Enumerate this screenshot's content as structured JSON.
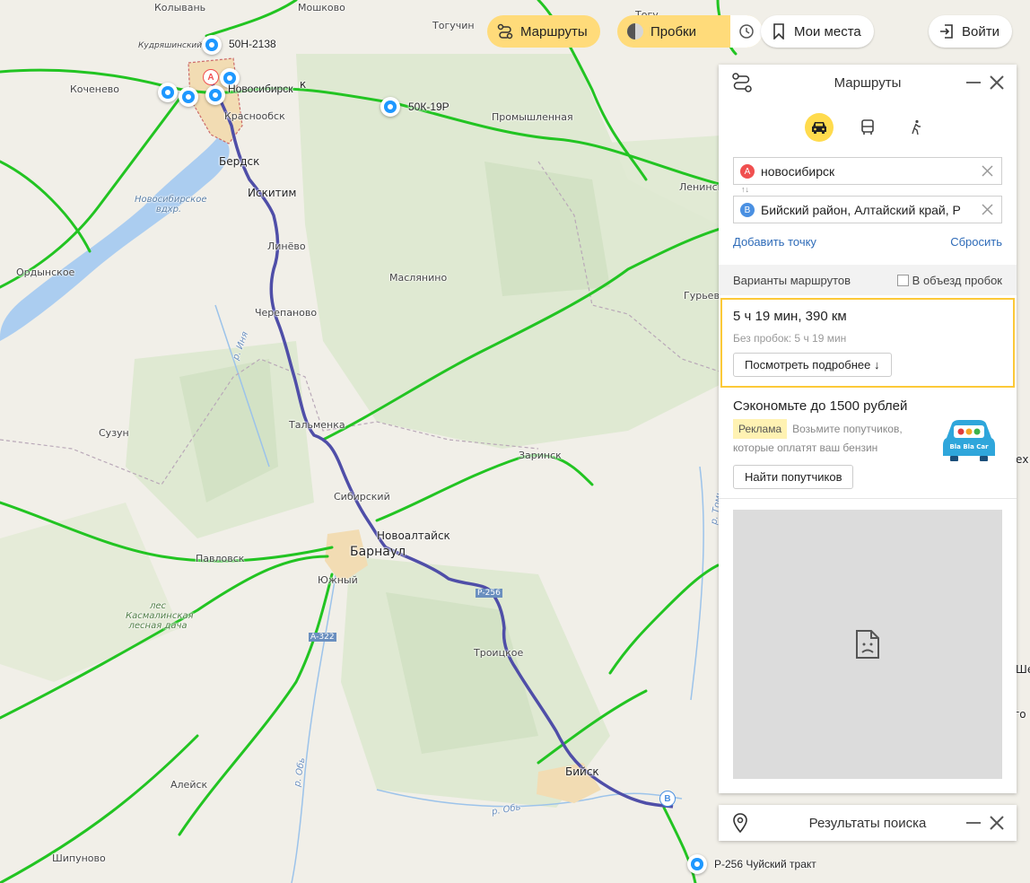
{
  "top_bar": {
    "routes_label": "Маршруты",
    "traffic_label": "Пробки",
    "places_label": "Мои места",
    "login_label": "Войти"
  },
  "map": {
    "pins": [
      {
        "label": "50Н-2138"
      },
      {
        "label": "Новосибирск"
      },
      {
        "label": "50К-19Р"
      },
      {
        "label": "Р-256 Чуйский тракт"
      }
    ],
    "route_pin_a": "A",
    "route_pin_b": "B",
    "places": {
      "kolyvan": "Колывань",
      "moshkovo": "Мошково",
      "toguchin": "Тогучин",
      "kochenevo": "Коченево",
      "kudryashi": "Кудряшинский",
      "krasnoobsk": "Краснообск",
      "promyshlennaya": "Промышленная",
      "berdsk": "Бердск",
      "iskitim": "Искитим",
      "leninsk": "Ленинск",
      "reservoir": "Новосибирское вдхр.",
      "linevo": "Линёво",
      "ordynskoe": "Ордынское",
      "maslyanino": "Маслянино",
      "guryevsk": "Гурьевск",
      "cherepanovo": "Черепаново",
      "inya": "р. Иня",
      "suzun": "Сузун",
      "talmenka": "Тальменка",
      "zarinsk": "Заринск",
      "sibirsky": "Сибирский",
      "novoaltaysk": "Новоалтайск",
      "barnaul": "Барнаул",
      "pavlovsk": "Павловск",
      "yuzhny": "Южный",
      "forest": "лес Касмалинская лесная дача",
      "troitskoe": "Троицкое",
      "ob": "р. Обь",
      "aleysk": "Алейск",
      "biysk": "Бийск",
      "shipunovo": "Шипуново",
      "road_a322": "А-322",
      "road_r256": "Р-256",
      "tom": "р. Томь",
      "edge_k": "к",
      "edge_tog": "Тогу",
      "edge_exe": "ех",
      "edge_she": "Ше",
      "edge_go": "го"
    }
  },
  "panel": {
    "title": "Маршруты",
    "point_a_badge": "A",
    "point_a": "новосибирск",
    "point_b_badge": "B",
    "point_b": "Бийский район, Алтайский край, Р",
    "add_point": "Добавить точку",
    "reset": "Сбросить",
    "variants_label": "Варианты маршрутов",
    "avoid_traffic_label": "В объезд пробок",
    "route_summary": "5 ч 19 мин, 390 км",
    "route_no_traffic": "Без пробок: 5 ч 19 мин",
    "details_button": "Посмотреть подробнее ↓",
    "ad_title": "Сэкономьте до 1500 рублей",
    "ad_badge": "Реклама",
    "ad_text": "Возьмите попутчиков, которые оплатят ваш бензин",
    "ad_button": "Найти попутчиков",
    "ad_logo_text": "Bla Bla Car"
  },
  "search_panel": {
    "title": "Результаты поиска"
  },
  "colors": {
    "route": "#4f4ea8",
    "road": "#22c422",
    "accent_yellow": "#ffdb4d",
    "pin_blue": "#1e98ff",
    "point_a": "#f05050",
    "point_b": "#4a90e2"
  }
}
